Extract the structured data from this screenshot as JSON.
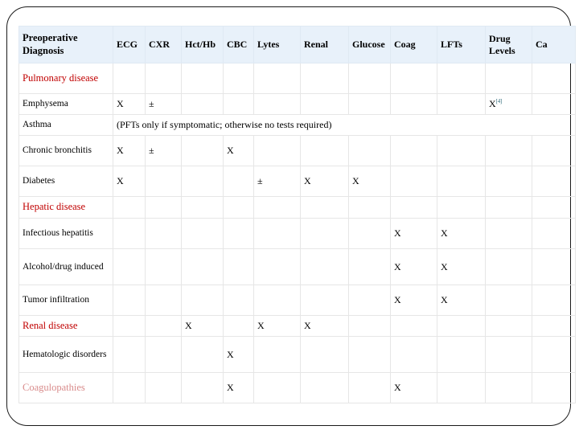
{
  "slide": {
    "title_row_label": "Preoperative Diagnosis"
  },
  "table": {
    "columns": [
      "Preoperative Diagnosis",
      "ECG",
      "CXR",
      "Hct/Hb",
      "CBC",
      "Lytes",
      "Renal",
      "Glucose",
      "Coag",
      "LFTs",
      "Drug Levels",
      "Ca"
    ],
    "colors": {
      "header_background": "#e8f1fa",
      "section_heading": "#c00000",
      "section_heading_light": "#d98c8c",
      "footnote": "#2e6b7a",
      "grid_line": "#e6e6e6",
      "frame": "#1a1a1a"
    },
    "rows": [
      {
        "label": "Pulmonary disease",
        "kind": "section",
        "cells": [
          "",
          "",
          "",
          "",
          "",
          "",
          "",
          "",
          "",
          ""
        ]
      },
      {
        "label": "Emphysema",
        "kind": "item",
        "cells": [
          "X",
          "±",
          "",
          "",
          "",
          "",
          "",
          "",
          "",
          ""
        ],
        "footnote_col": 9,
        "footnote_mark": "X",
        "footnote_ref": "[4]"
      },
      {
        "label": "Asthma",
        "kind": "item",
        "note": "(PFTs only if symptomatic; otherwise no tests required)"
      },
      {
        "label": "Chronic bronchitis",
        "kind": "item",
        "cells": [
          "X",
          "±",
          "",
          "X",
          "",
          "",
          "",
          "",
          "",
          ""
        ]
      },
      {
        "label": "Diabetes",
        "kind": "item",
        "cells": [
          "X",
          "",
          "",
          "",
          "±",
          "X",
          "X",
          "",
          "",
          ""
        ]
      },
      {
        "label": "Hepatic disease",
        "kind": "section",
        "cells": [
          "",
          "",
          "",
          "",
          "",
          "",
          "",
          "",
          "",
          ""
        ]
      },
      {
        "label": "Infectious hepatitis",
        "kind": "item",
        "cells": [
          "",
          "",
          "",
          "",
          "",
          "",
          "",
          "X",
          "X",
          ""
        ]
      },
      {
        "label": "Alcohol/drug induced",
        "kind": "item",
        "cells": [
          "",
          "",
          "",
          "",
          "",
          "",
          "",
          "X",
          "X",
          ""
        ]
      },
      {
        "label": "Tumor infiltration",
        "kind": "item",
        "cells": [
          "",
          "",
          "",
          "",
          "",
          "",
          "",
          "X",
          "X",
          ""
        ]
      },
      {
        "label": "Renal disease",
        "kind": "section",
        "cells": [
          "",
          "",
          "X",
          "",
          "X",
          "X",
          "",
          "",
          "",
          ""
        ]
      },
      {
        "label": "Hematologic disorders",
        "kind": "item",
        "cells": [
          "",
          "",
          "",
          "X",
          "",
          "",
          "",
          "",
          "",
          ""
        ]
      },
      {
        "label": "Coagulopathies",
        "kind": "section-light",
        "cells": [
          "",
          "",
          "",
          "X",
          "",
          "",
          "",
          "X",
          "",
          ""
        ]
      }
    ]
  }
}
